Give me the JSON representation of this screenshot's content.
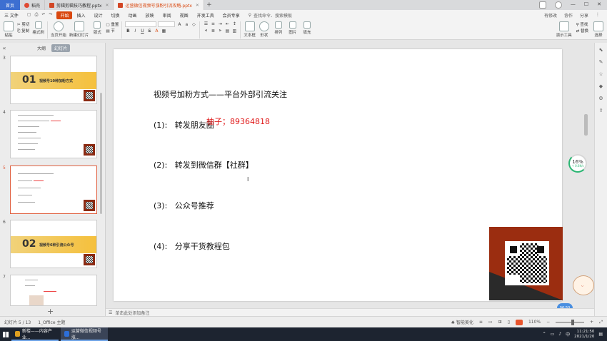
{
  "tabs": {
    "home": "首页",
    "items": [
      {
        "label": "稻壳",
        "icon": "wps-icon"
      },
      {
        "label": "剪辑剪辑技巧教程.pptx",
        "icon": "ppt-icon"
      },
      {
        "label": "运营微信视频号涨粉引流攻略.pptx",
        "icon": "ppt-icon",
        "active": true
      }
    ],
    "new_tab": "+"
  },
  "menu": {
    "file": "三 文件",
    "items": [
      "开始",
      "插入",
      "设计",
      "切换",
      "动画",
      "放映",
      "审阅",
      "视图",
      "开发工具",
      "会员专享"
    ],
    "search": "查找命令、搜索模板",
    "right": [
      "有修改",
      "协作",
      "分享"
    ]
  },
  "ribbon": {
    "clipboard": [
      "粘贴",
      "剪切",
      "复制",
      "格式刷"
    ],
    "play": "当页开始",
    "new_slide": "新建幻灯片",
    "layout": "版式",
    "section": "节",
    "reset": "重置",
    "format_btns": [
      "B",
      "I",
      "U",
      "S"
    ],
    "paragraph": [
      "文本框",
      "形状",
      "排列",
      "图片",
      "填充"
    ],
    "right": [
      "演示工具",
      "查找",
      "替换",
      "选择"
    ]
  },
  "left_panel": {
    "tab_outline": "大纲",
    "tab_slides": "幻灯片",
    "slides": [
      {
        "num": "3",
        "band_num": "01",
        "band_title": "视频号10种加粉方式"
      },
      {
        "num": "4"
      },
      {
        "num": "5",
        "selected": true
      },
      {
        "num": "6",
        "band_num": "02",
        "band_title": "视频号6种引流公众号"
      },
      {
        "num": "7"
      }
    ],
    "add": "+"
  },
  "slide": {
    "title": "视频号加粉方式——平台外部引流关注",
    "items": [
      {
        "num": "(1):",
        "text": "转发朋友圈"
      },
      {
        "num": "(2):",
        "text": "转发到微信群【社群】"
      },
      {
        "num": "(3):",
        "text": "公众号推荐"
      },
      {
        "num": "(4):",
        "text": "分享干货教程包"
      }
    ],
    "overlay_text": "柚子；89364818"
  },
  "notes": {
    "placeholder": "单击此处添加备注"
  },
  "progress_badge": {
    "percent": "16%",
    "speed": "↑ 0.6K/s",
    "value": 0.16
  },
  "blue_pill": "06:50",
  "status": {
    "slide": "幻灯片 5 / 13",
    "theme": "1_Office 主题",
    "smart": "智能美化",
    "zoom": "110%"
  },
  "taskbar": {
    "items": [
      {
        "label": "新楼——内容产业...",
        "active": false
      },
      {
        "label": "运营微信视频号涨...",
        "active": true
      }
    ],
    "time": "11:21:50",
    "date": "2021/1/20"
  },
  "colors": {
    "accent": "#d9480f",
    "home_tab": "#3d6fd1",
    "overlay_red": "#e01818",
    "qr_bg": "#9b2d10",
    "taskbar": "#1d2430"
  }
}
